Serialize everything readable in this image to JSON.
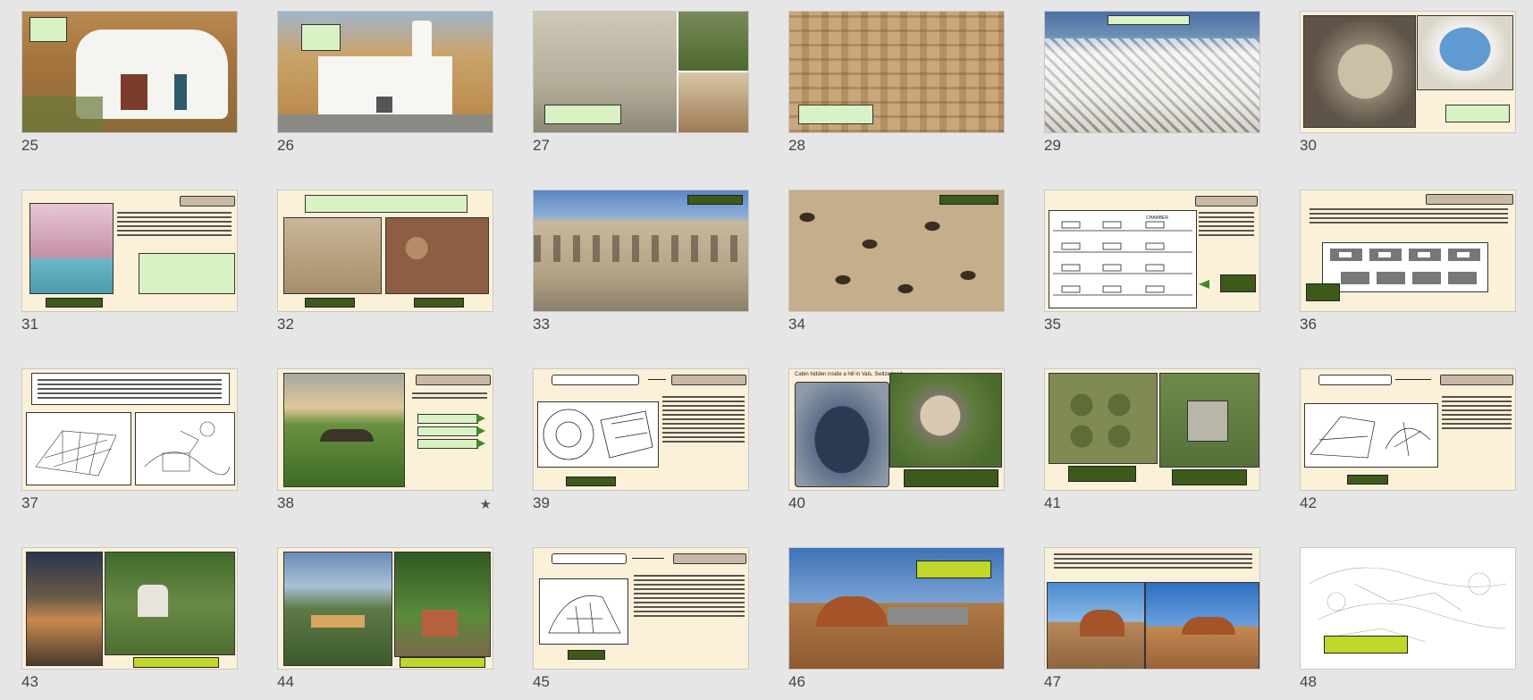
{
  "window": {
    "view": "slide-sorter"
  },
  "slides": [
    {
      "number": "25",
      "starred": false
    },
    {
      "number": "26",
      "starred": false
    },
    {
      "number": "27",
      "starred": false
    },
    {
      "number": "28",
      "starred": false
    },
    {
      "number": "29",
      "starred": false
    },
    {
      "number": "30",
      "starred": false
    },
    {
      "number": "31",
      "starred": false
    },
    {
      "number": "32",
      "starred": false
    },
    {
      "number": "33",
      "starred": false
    },
    {
      "number": "34",
      "starred": false
    },
    {
      "number": "35",
      "starred": false
    },
    {
      "number": "36",
      "starred": false
    },
    {
      "number": "37",
      "starred": false
    },
    {
      "number": "38",
      "starred": true
    },
    {
      "number": "39",
      "starred": false
    },
    {
      "number": "40",
      "starred": false
    },
    {
      "number": "41",
      "starred": false
    },
    {
      "number": "42",
      "starred": false
    },
    {
      "number": "43",
      "starred": false
    },
    {
      "number": "44",
      "starred": false
    },
    {
      "number": "45",
      "starred": false
    },
    {
      "number": "46",
      "starred": false
    },
    {
      "number": "47",
      "starred": false
    },
    {
      "number": "48",
      "starred": false
    }
  ],
  "slide_text": {
    "s40_caption": "Cabin hidden inside a hill in Vals, Switzerland",
    "s35_chamber": "CHAMBER"
  },
  "icons": {
    "star": "★"
  },
  "colors": {
    "background": "#e6e6e6",
    "slide_cream": "#fbf0d8",
    "title_tag": "#c9b8a6",
    "dark_green": "#3d5a1a",
    "light_green": "#d9f2c4"
  }
}
